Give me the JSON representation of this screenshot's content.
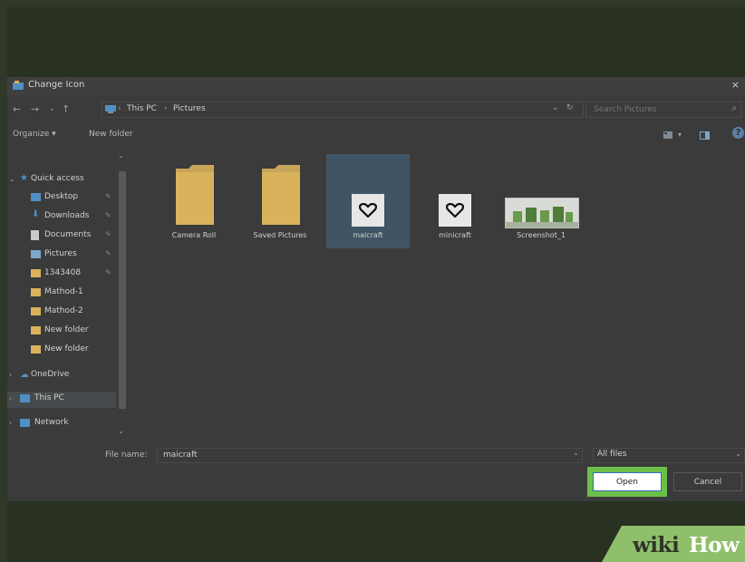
{
  "dialog": {
    "title": "Change Icon",
    "close_glyph": "×"
  },
  "address_bar": {
    "back": "←",
    "forward": "→",
    "recent": "⌄",
    "up": "↑",
    "separator": "›",
    "crumbs": [
      "This PC",
      "Pictures"
    ],
    "dropdown": "⌄",
    "refresh": "↻",
    "search_placeholder": "Search Pictures"
  },
  "toolbar": {
    "organize_label": "Organize ▾",
    "new_folder_label": "New folder",
    "view_caret": "▾",
    "help_glyph": "?"
  },
  "navigation": {
    "quick_access": "Quick access",
    "items": [
      {
        "label": "Desktop",
        "pinned": true
      },
      {
        "label": "Downloads",
        "pinned": true
      },
      {
        "label": "Documents",
        "pinned": true
      },
      {
        "label": "Pictures",
        "pinned": true
      },
      {
        "label": "1343408",
        "pinned": true
      },
      {
        "label": "Mathod-1",
        "pinned": false
      },
      {
        "label": "Mathod-2",
        "pinned": false
      },
      {
        "label": "New folder",
        "pinned": false
      },
      {
        "label": "New folder",
        "pinned": false
      }
    ],
    "onedrive": "OneDrive",
    "this_pc": "This PC",
    "network": "Network"
  },
  "files": [
    {
      "name": "Camera Roll",
      "kind": "folder"
    },
    {
      "name": "Saved Pictures",
      "kind": "folder"
    },
    {
      "name": "maicraft",
      "kind": "icon",
      "selected": true
    },
    {
      "name": "minicraft",
      "kind": "icon"
    },
    {
      "name": "Screenshot_1",
      "kind": "image"
    }
  ],
  "footer": {
    "file_name_label": "File name:",
    "file_name_value": "maicraft",
    "filter_value": "All files",
    "open_label": "Open",
    "cancel_label": "Cancel"
  },
  "watermark": {
    "part1": "wiki",
    "part2": "How"
  },
  "colors": {
    "highlight": "#6cc04a",
    "folder": "#d9b25c",
    "selection": "#3f5565",
    "brand_green": "#8fbf6a"
  },
  "icons": {
    "nav_back": "arrow-left-icon",
    "nav_forward": "arrow-right-icon",
    "nav_up": "arrow-up-icon",
    "pin": "pin-icon",
    "search": "search-icon",
    "help": "help-icon"
  }
}
